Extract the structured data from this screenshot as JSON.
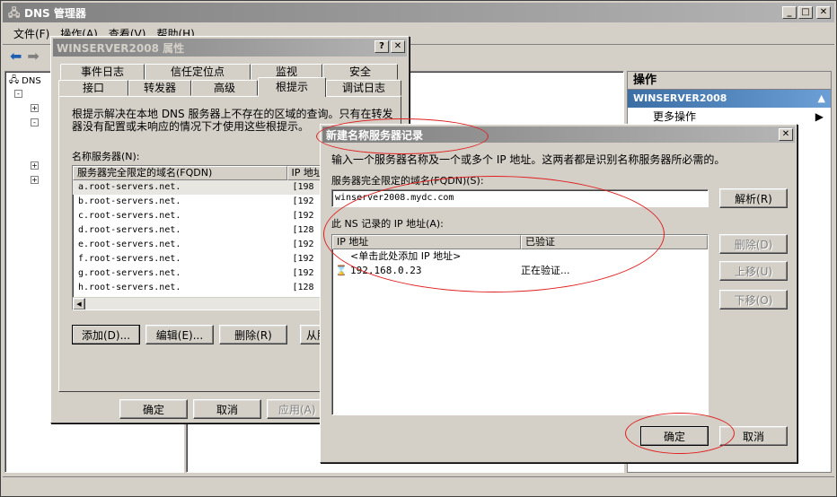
{
  "main_window": {
    "title": "DNS 管理器",
    "menu": [
      "文件(F)",
      "操作(A)",
      "查看(V)",
      "帮助(H)"
    ],
    "tree_root": "DNS"
  },
  "actions_pane": {
    "title": "操作",
    "section": "WINSERVER2008",
    "more_actions": "更多操作"
  },
  "props_dialog": {
    "title": "WINSERVER2008 属性",
    "tabs_row1": [
      "事件日志",
      "信任定位点",
      "监视",
      "安全"
    ],
    "tabs_row2": [
      "接口",
      "转发器",
      "高级",
      "根提示",
      "调试日志"
    ],
    "description": "根提示解决在本地 DNS 服务器上不存在的区域的查询。只有在转发器没有配置或未响应的情况下才使用这些根提示。",
    "name_servers_label": "名称服务器(N):",
    "columns": [
      "服务器完全限定的域名(FQDN)",
      "IP 地址"
    ],
    "rows": [
      {
        "fqdn": "a.root-servers.net.",
        "ip": "[198"
      },
      {
        "fqdn": "b.root-servers.net.",
        "ip": "[192"
      },
      {
        "fqdn": "c.root-servers.net.",
        "ip": "[192"
      },
      {
        "fqdn": "d.root-servers.net.",
        "ip": "[128"
      },
      {
        "fqdn": "e.root-servers.net.",
        "ip": "[192"
      },
      {
        "fqdn": "f.root-servers.net.",
        "ip": "[192"
      },
      {
        "fqdn": "g.root-servers.net.",
        "ip": "[192"
      },
      {
        "fqdn": "h.root-servers.net.",
        "ip": "[128"
      }
    ],
    "add_button": "添加(D)...",
    "edit_button": "编辑(E)...",
    "delete_button": "删除(R)",
    "copy_button": "从服",
    "ok_button": "确定",
    "cancel_button": "取消",
    "apply_button": "应用(A)"
  },
  "ns_dialog": {
    "title": "新建名称服务器记录",
    "description": "输入一个服务器名称及一个或多个 IP 地址。这两者都是识别名称服务器所必需的。",
    "fqdn_label": "服务器完全限定的域名(FQDN)(S):",
    "fqdn_value": "winserver2008.mydc.com",
    "resolve_button": "解析(R)",
    "ip_label": "此 NS 记录的 IP 地址(A):",
    "columns": [
      "IP 地址",
      "已验证"
    ],
    "add_hint": "<单击此处添加 IP 地址>",
    "entries": [
      {
        "ip": "192.168.0.23",
        "status": "正在验证..."
      }
    ],
    "delete_button": "删除(D)",
    "up_button": "上移(U)",
    "down_button": "下移(O)",
    "ok_button": "确定",
    "cancel_button": "取消"
  }
}
